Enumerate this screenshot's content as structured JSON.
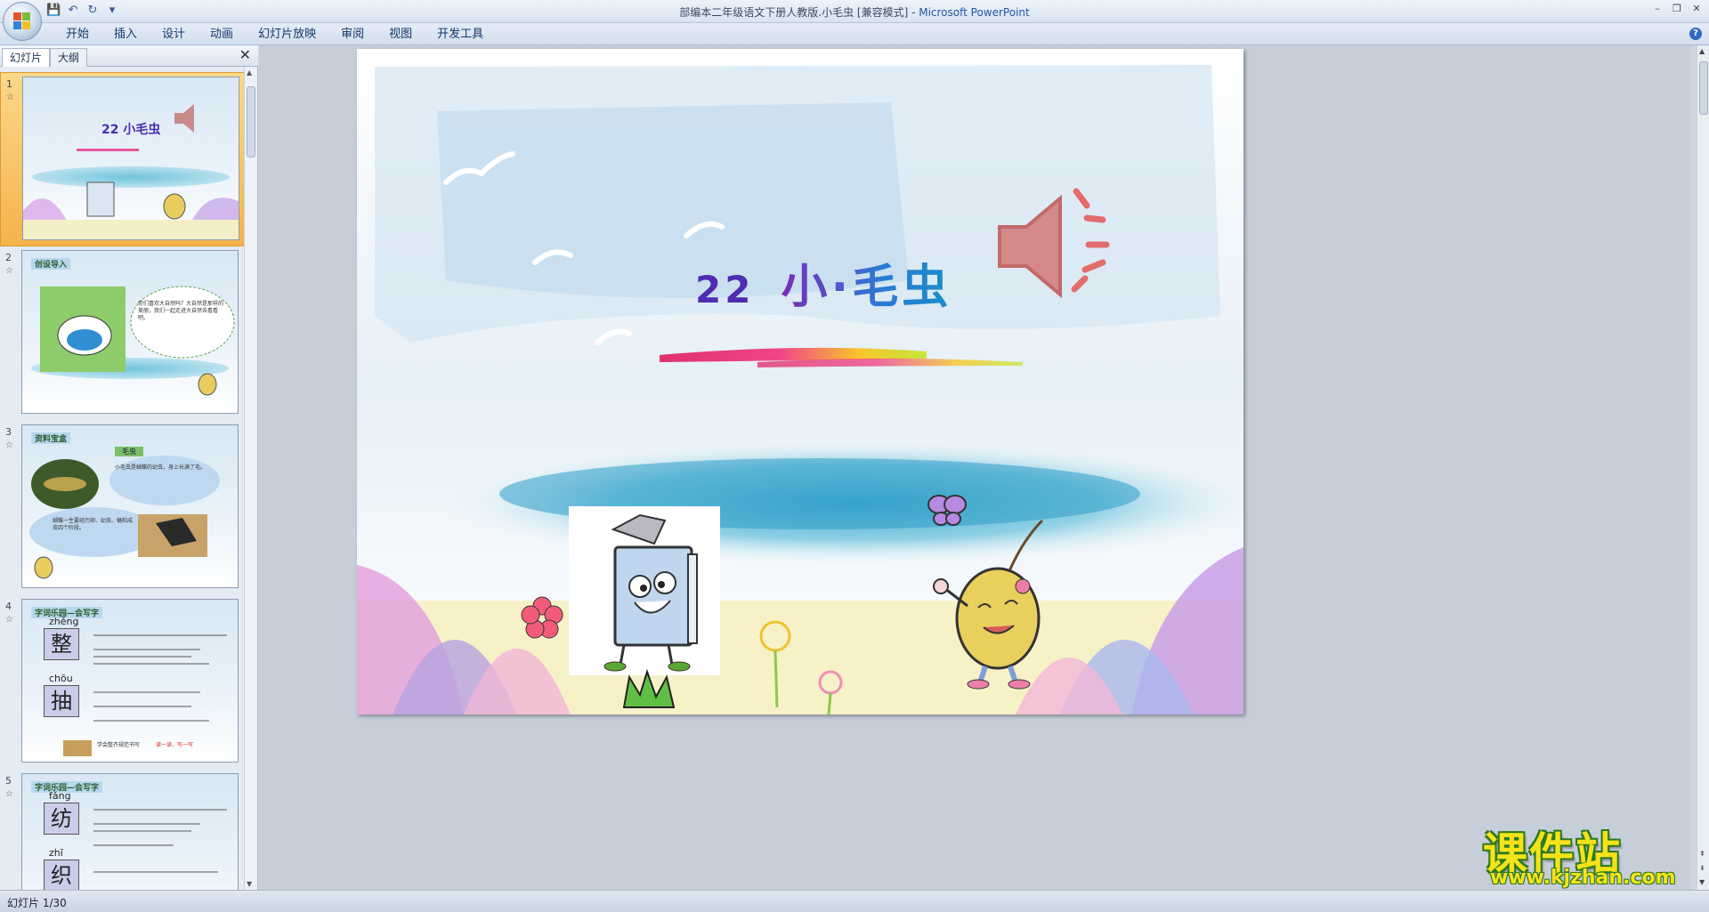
{
  "window": {
    "title": "部编本二年级语文下册人教版.小毛虫 [兼容模式] - ",
    "app_name": "Microsoft PowerPoint",
    "controls": [
      "–",
      "❐",
      "✕"
    ]
  },
  "qat": {
    "save_icon": "💾",
    "undo_icon": "↶",
    "redo_icon": "↻",
    "customize_icon": "▾"
  },
  "ribbon": {
    "tabs": [
      "开始",
      "插入",
      "设计",
      "动画",
      "幻灯片放映",
      "审阅",
      "视图",
      "开发工具"
    ],
    "help": "?"
  },
  "left_pane": {
    "tabs": [
      "幻灯片",
      "大纲"
    ],
    "close": "✕",
    "slides": [
      {
        "num": "1",
        "title": "22 小毛虫"
      },
      {
        "num": "2",
        "heading": "创设导入",
        "bubble": "你们喜欢大自然吗？大自然是那样的美丽，我们一起走进大自然去看看吧。"
      },
      {
        "num": "3",
        "heading": "资料宝盒",
        "tag": "毛虫",
        "note": "小毛虫是蝴蝶的幼虫，身上长满了毛。",
        "note2": "蝴蝶一生要经历卵、幼虫、蛹和成虫四个阶段。"
      },
      {
        "num": "4",
        "heading": "字词乐园—会写字",
        "chars": [
          {
            "pinyin": "zhěng",
            "char": "整"
          },
          {
            "pinyin": "chōu",
            "char": "抽"
          }
        ],
        "tip": "学会整齐规范书写",
        "tip_red": "读一读、写一写"
      },
      {
        "num": "5",
        "heading": "字词乐园—会写字",
        "chars": [
          {
            "pinyin": "fǎng",
            "char": "纺"
          },
          {
            "pinyin": "zhī",
            "char": "织"
          }
        ]
      }
    ]
  },
  "slide": {
    "title_num": "22",
    "title_name": "小·毛虫"
  },
  "watermark": {
    "text": "课件站",
    "url": "www.kjzhan.com"
  },
  "status": {
    "text": "幻灯片 1/30"
  },
  "colors": {
    "accent": "#2456a6",
    "selection": "#f5b34b",
    "title_purple": "#4e2bb0"
  }
}
